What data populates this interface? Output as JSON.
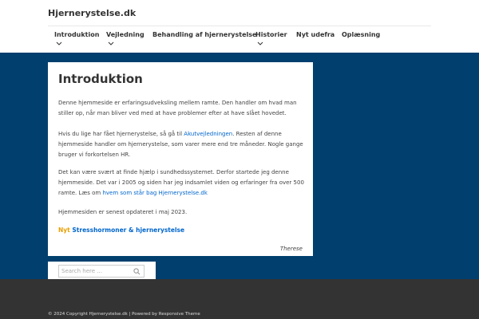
{
  "site": {
    "title": "Hjernerystelse.dk"
  },
  "nav": {
    "items": [
      {
        "label": "Introduktion"
      },
      {
        "label": "Vejledning"
      },
      {
        "label": "Behandling af hjernerystelse"
      },
      {
        "label": "Historier"
      },
      {
        "label": "Nyt udefra"
      },
      {
        "label": "Oplæsning"
      }
    ]
  },
  "content": {
    "title": "Introduktion",
    "p1": "Denne hjemmeside er erfaringsudveksling mellem ramte. Den handler om hvad man stiller op, når man bliver ved med at have problemer efter at have slået hovedet.",
    "p2_pre": "Hvis du lige har fået hjernerystelse, så gå til ",
    "p2_link": "Akutvejledningen",
    "p2_post": ". Resten af denne hjemmeside handler om hjernerystelse, som varer mere end tre måneder. Nogle gange bruger vi forkortelsen HR.",
    "p3_pre": "Det kan være svært at finde hjælp i sundhedssystemet. Derfor startede jeg denne hjemmeside. Det var i 2005 og siden har jeg indsamlet viden og erfaringer fra over 500 ramte. Læs om ",
    "p3_link": "hvem som står bag Hjernerystelse.dk",
    "p4": "Hjemmesiden er senest opdateret i maj 2023.",
    "news_tag": "Nyt",
    "news_link": "Stresshormoner & hjernerystelse",
    "signature": "Therese"
  },
  "search": {
    "placeholder": "Search here ..."
  },
  "footer": {
    "text": "© 2024 Copyright Hjernerystelse.dk | Powered by Responsive Theme"
  },
  "colors": {
    "main_bg": "#003f6e",
    "link": "#0066cc",
    "news_tag": "#e8a000",
    "footer_bg": "#333333"
  }
}
